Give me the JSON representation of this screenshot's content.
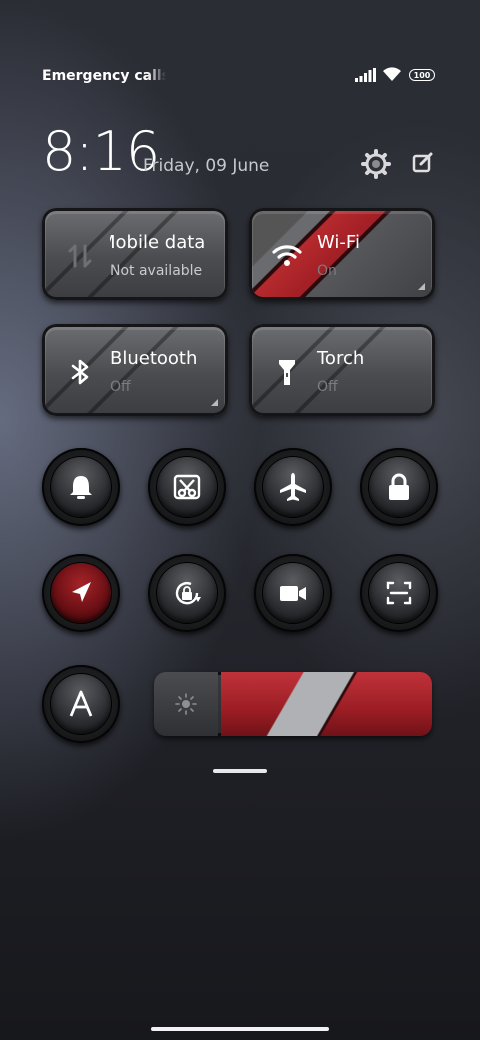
{
  "status_bar": {
    "carrier_text": "Emergency calls only",
    "battery_level": "100"
  },
  "clock": {
    "time": "8:16",
    "date": "Friday, 09 June"
  },
  "tiles": [
    {
      "title": "Mobile data",
      "subtitle": "Not available",
      "icon": "mobile-data-icon",
      "active": false
    },
    {
      "title": "Wi-Fi",
      "subtitle": "On",
      "icon": "wifi-icon",
      "active": true
    },
    {
      "title": "Bluetooth",
      "subtitle": "Off",
      "icon": "bluetooth-icon",
      "active": false
    },
    {
      "title": "Torch",
      "subtitle": "Off",
      "icon": "torch-icon",
      "active": false
    }
  ],
  "toggles": [
    {
      "name": "ringer",
      "icon": "bell-icon",
      "active": false
    },
    {
      "name": "screenshot",
      "icon": "scissors-icon",
      "active": false
    },
    {
      "name": "airplane-mode",
      "icon": "airplane-icon",
      "active": false
    },
    {
      "name": "lock-screen",
      "icon": "lock-icon",
      "active": false
    },
    {
      "name": "location",
      "icon": "location-arrow-icon",
      "active": true
    },
    {
      "name": "rotation-lock",
      "icon": "rotation-lock-icon",
      "active": false
    },
    {
      "name": "screen-recorder",
      "icon": "video-camera-icon",
      "active": false
    },
    {
      "name": "scanner",
      "icon": "scan-frame-icon",
      "active": false
    },
    {
      "name": "auto-brightness",
      "icon": "letter-a-icon",
      "active": false
    }
  ],
  "brightness": {
    "level": 0.62,
    "icon": "sun-icon"
  },
  "colors": {
    "accent": "#b52a2e",
    "background": "#2a2c33"
  }
}
